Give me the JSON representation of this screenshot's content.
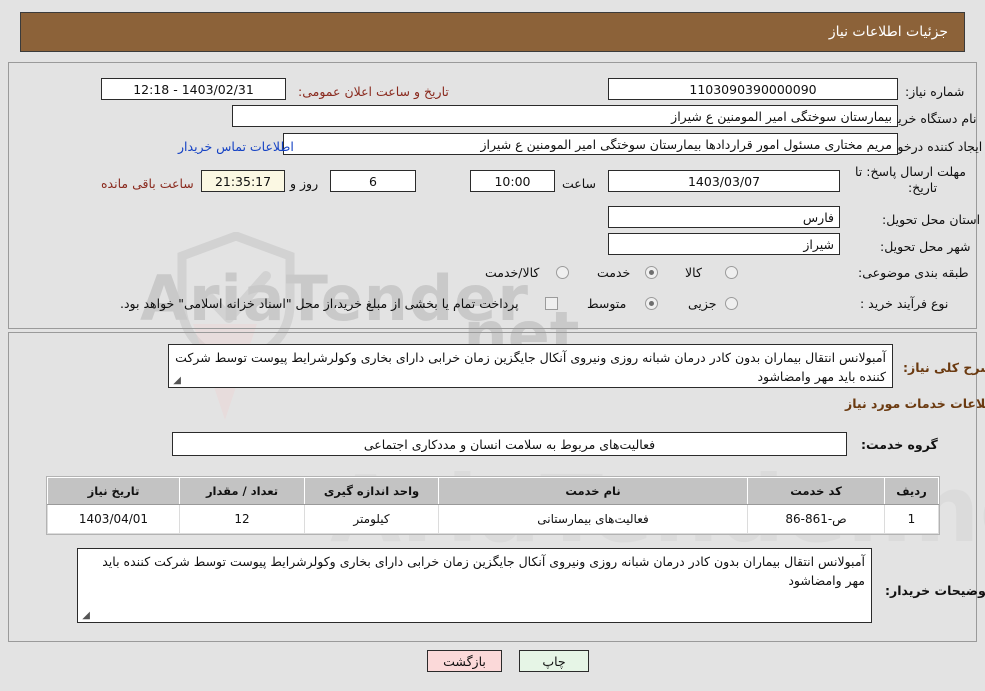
{
  "header": {
    "title": "جزئیات اطلاعات نیاز",
    "bg": "#8c6239",
    "fg": "#ffffff"
  },
  "watermark": {
    "text_left": "AriaTender",
    "text_right": ".net",
    "brand": "AriaTender.net"
  },
  "top": {
    "need_number_label": "شماره نیاز:",
    "need_number_value": "1103090390000090",
    "announce_label": "تاریخ و ساعت اعلان عمومی:",
    "announce_value": "1403/02/31 - 12:18",
    "buyer_org_label": "نام دستگاه خریدار:",
    "buyer_org_value": "بیمارستان سوختگی امیر المومنین  ع  شیراز",
    "requester_label": "ایجاد کننده درخواست:",
    "requester_value": "مریم مختاری مسئول امور قراردادها بیمارستان سوختگی امیر المومنین  ع  شیراز",
    "contact_link": "اطلاعات تماس خریدار",
    "deadline_label": "مهلت ارسال پاسخ: تا تاریخ:",
    "deadline_date": "1403/03/07",
    "hour_label": "ساعت",
    "deadline_time": "10:00",
    "days_value": "6",
    "days_label": "روز و",
    "countdown_value": "21:35:17",
    "remaining_label": "ساعت باقی مانده",
    "province_label": "استان محل تحویل:",
    "province_value": "فارس",
    "city_label": "شهر محل تحویل:",
    "city_value": "شیراز",
    "category_label": "طبقه بندی موضوعی:",
    "radio_goods": "کالا",
    "radio_service": "خدمت",
    "radio_goods_service": "کالا/خدمت",
    "radio_selected": "خدمت",
    "process_label": "نوع فرآیند خرید :",
    "radio_minor": "جزیی",
    "radio_medium": "متوسط",
    "process_selected": "متوسط",
    "treasury_checkbox_label": "پرداخت تمام یا بخشی از مبلغ خرید،از محل \"اسناد خزانه اسلامی\" خواهد بود.",
    "treasury_checked": false
  },
  "body": {
    "summary_label": "شرح کلی نیاز:",
    "summary_value": "آمبولانس انتقال بیماران بدون کادر درمان شبانه روزی ونیروی آنکال جایگزین زمان خرابی دارای بخاری وکولرشرایط پیوست توسط شرکت کننده باید مهر وامضاشود",
    "services_section_title": "اطلاعات خدمات مورد نیاز",
    "service_group_label": "گروه خدمت:",
    "service_group_value": "فعالیت‌های مربوط به سلامت انسان و مددکاری اجتماعی",
    "buyer_notes_label": "توضیحات خریدار:",
    "buyer_notes_value": "آمبولانس انتقال بیماران بدون کادر درمان شبانه روزی ونیروی آنکال جایگزین زمان خرابی دارای بخاری وکولرشرایط پیوست توسط شرکت کننده باید مهر وامضاشود"
  },
  "table": {
    "columns": [
      "ردیف",
      "کد خدمت",
      "نام خدمت",
      "واحد اندازه گیری",
      "تعداد / مقدار",
      "تاریخ نیاز"
    ],
    "rows": [
      {
        "row": "1",
        "code": "ص-861-86",
        "name": "فعالیت‌های بیمارستانی",
        "unit": "کیلومتر",
        "qty": "12",
        "date": "1403/04/01"
      }
    ]
  },
  "footer": {
    "print_label": "چاپ",
    "back_label": "بازگشت"
  }
}
